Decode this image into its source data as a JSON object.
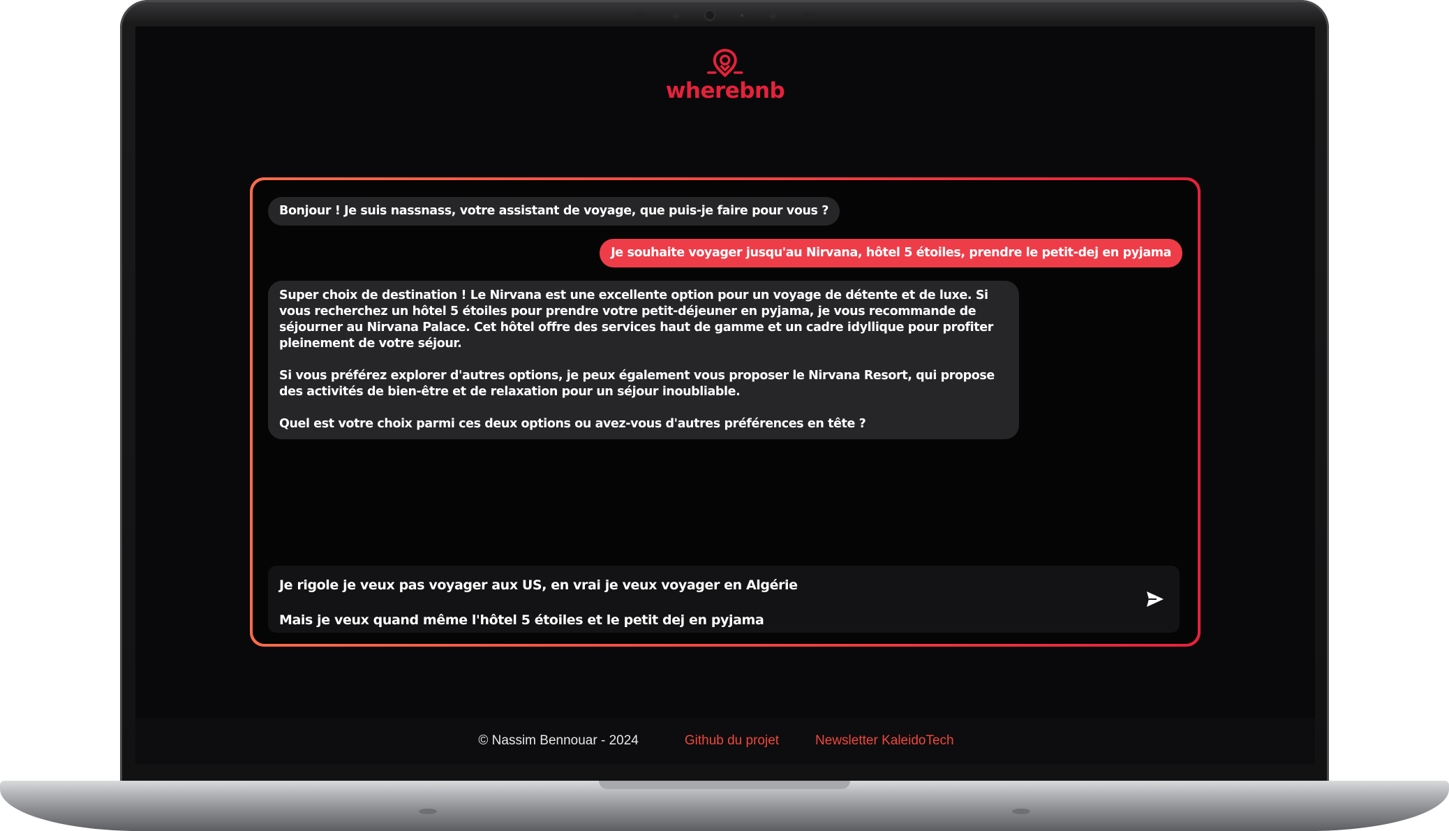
{
  "app": {
    "logo_text": "wherebnb",
    "accent_color": "#e6213b"
  },
  "chat": {
    "messages": [
      {
        "role": "assistant",
        "text": "Bonjour ! Je suis nassnass, votre assistant de voyage, que puis-je faire pour vous ?"
      },
      {
        "role": "user",
        "text": "Je souhaite voyager jusqu'au Nirvana, hôtel 5 étoiles, prendre le petit-dej en pyjama"
      },
      {
        "role": "assistant",
        "paragraphs": [
          "Super choix de destination ! Le Nirvana est une excellente option pour un voyage de détente et de luxe. Si vous recherchez un hôtel 5 étoiles pour prendre votre petit-déjeuner en pyjama, je vous recommande de séjourner au Nirvana Palace. Cet hôtel offre des services haut de gamme et un cadre idyllique pour profiter pleinement de votre séjour.",
          "Si vous préférez explorer d'autres options, je peux également vous proposer le Nirvana Resort, qui propose des activités de bien-être et de relaxation pour un séjour inoubliable.",
          "Quel est votre choix parmi ces deux options ou avez-vous d'autres préférences en tête ?"
        ]
      }
    ],
    "input": {
      "line1": "Je rigole je veux pas voyager aux US, en vrai je veux voyager en Algérie",
      "line2": "Mais je veux quand même l'hôtel 5 étoiles et le petit dej en pyjama"
    },
    "send_icon": "send-icon"
  },
  "footer": {
    "copyright": "© Nassim Bennouar - 2024",
    "links": [
      {
        "label": "Github du projet"
      },
      {
        "label": "Newsletter KaleidoTech"
      }
    ]
  }
}
